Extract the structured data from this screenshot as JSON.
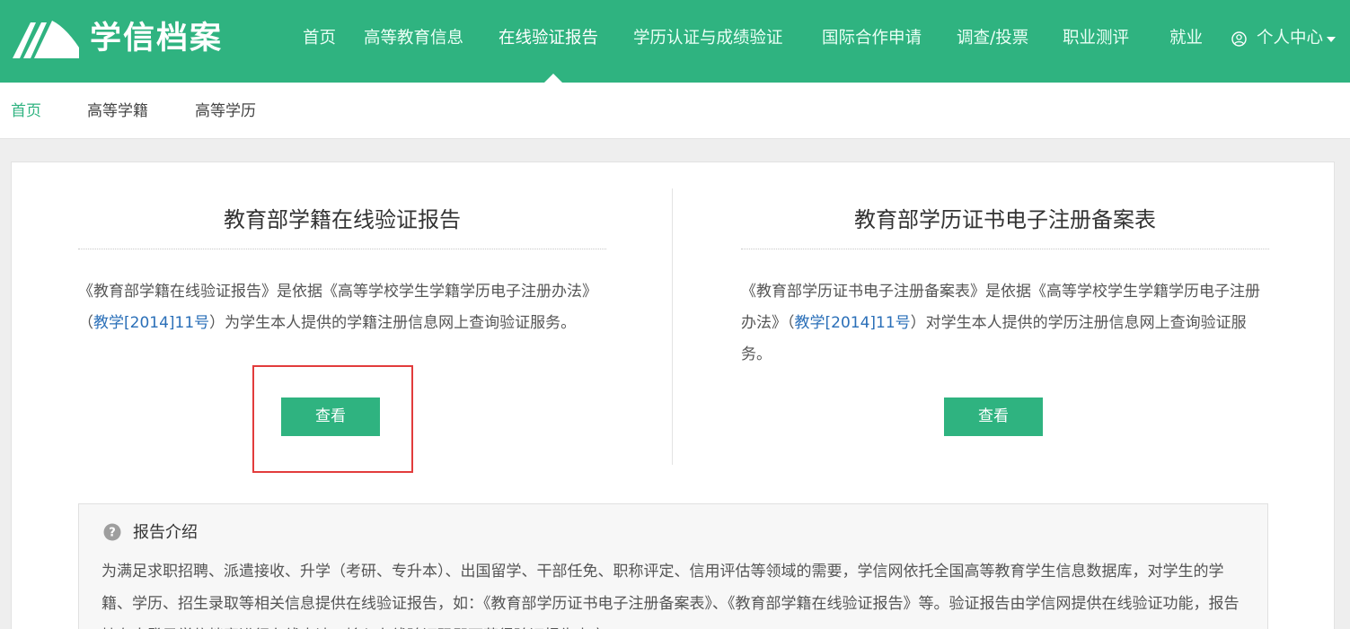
{
  "header": {
    "logo_text": "学信档案",
    "nav": [
      {
        "label": "首页"
      },
      {
        "label": "高等教育信息"
      },
      {
        "label": "在线验证报告",
        "active": true
      },
      {
        "label": "学历认证与成绩验证"
      },
      {
        "label": "国际合作申请"
      },
      {
        "label": "调查/投票"
      },
      {
        "label": "职业测评"
      },
      {
        "label": "就业"
      }
    ],
    "user_menu_label": "个人中心",
    "user_icon": "user-circle-icon",
    "caret_icon": "caret-down-icon"
  },
  "subnav": {
    "items": [
      {
        "label": "首页",
        "active": true
      },
      {
        "label": "高等学籍"
      },
      {
        "label": "高等学历"
      }
    ]
  },
  "panels": [
    {
      "title": "教育部学籍在线验证报告",
      "desc_before": "《教育部学籍在线验证报告》是依据《高等学校学生学籍学历电子注册办法》（",
      "desc_link": "教学[2014]11号",
      "desc_after": "）为学生本人提供的学籍注册信息网上查询验证服务。",
      "button_label": "查看"
    },
    {
      "title": "教育部学历证书电子注册备案表",
      "desc_before": "《教育部学历证书电子注册备案表》是依据《高等学校学生学籍学历电子注册办法》（",
      "desc_link": "教学[2014]11号",
      "desc_after": "）对学生本人提供的学历注册信息网上查询验证服务。",
      "button_label": "查看"
    }
  ],
  "intro": {
    "title": "报告介绍",
    "icon": "question-circle-icon",
    "body": "为满足求职招聘、派遣接收、升学（考研、专升本）、出国留学、干部任免、职称评定、信用评估等领域的需要，学信网依托全国高等教育学生信息数据库，对学生的学籍、学历、招生录取等相关信息提供在线验证报告，如：《教育部学历证书电子注册备案表》、《教育部学籍在线验证报告》等。验证报告由学信网提供在线验证功能，报告持有人登录学信档案进行在线申请，输入在线验证码即可获得验证报告内容。"
  },
  "colors": {
    "brand": "#2fb380",
    "link": "#2a6fb8",
    "highlight": "#e23c3c"
  }
}
